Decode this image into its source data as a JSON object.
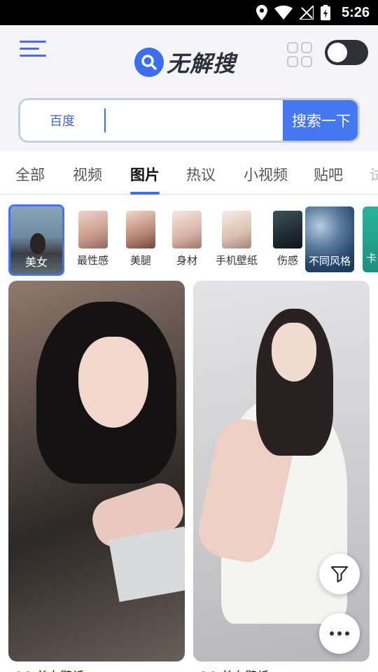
{
  "status_bar": {
    "time": "5:26",
    "icons": [
      "location-icon",
      "wifi-icon",
      "no-signal-icon",
      "battery-charging-icon"
    ]
  },
  "header": {
    "menu_icon": "menu-icon",
    "logo_text": "无解搜",
    "grid_icon": "grid-icon",
    "toggle_state": "off"
  },
  "search": {
    "engine_label": "百度",
    "input_value": "",
    "button_label": "搜索一下",
    "accent_color": "#4577f2"
  },
  "tabs": {
    "items": [
      "全部",
      "视频",
      "图片",
      "热议",
      "小视频",
      "贴吧",
      "试"
    ],
    "active": "图片"
  },
  "categories": {
    "items": [
      "美女",
      "最性感",
      "美腿",
      "身材",
      "手机壁纸",
      "伤感",
      "不同风格",
      "卡"
    ],
    "selected": "美女"
  },
  "feed": {
    "captions": [
      "QQ 美女壁纸",
      "QQ 美女壁纸"
    ],
    "filter_icon": "filter-icon",
    "more_icon": "more-icon"
  }
}
